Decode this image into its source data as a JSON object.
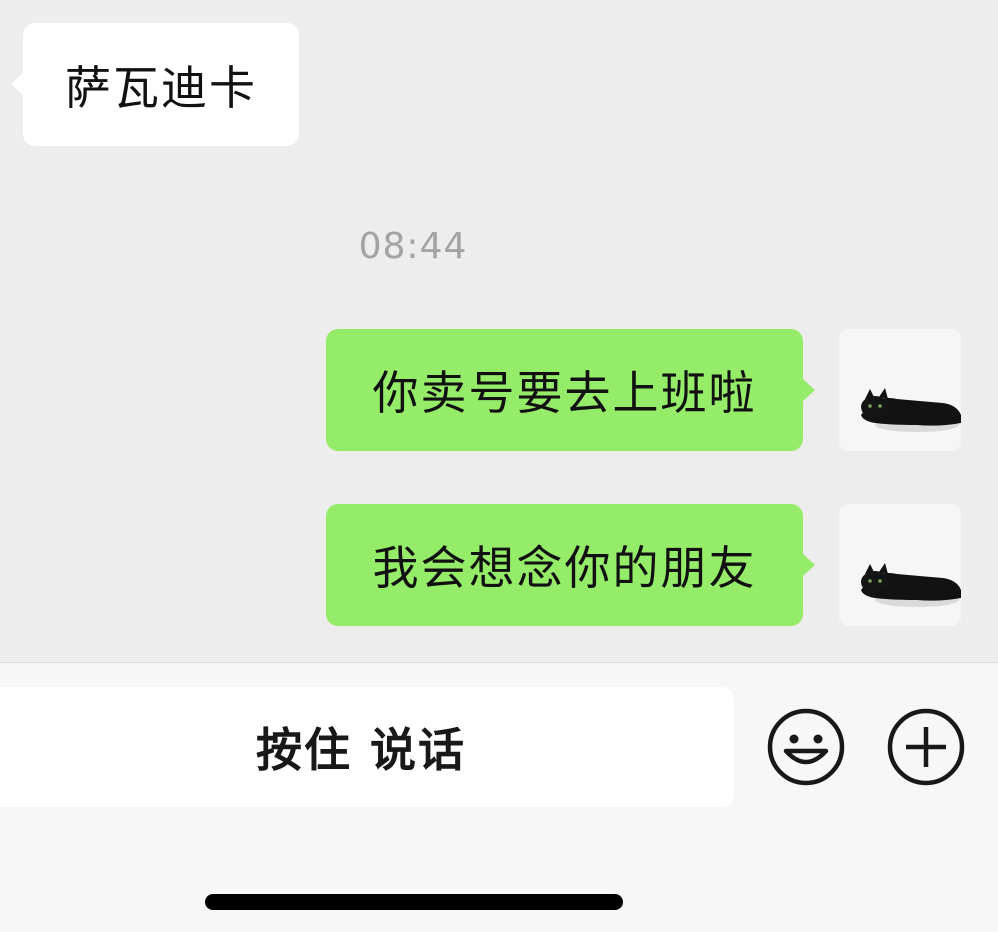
{
  "chat": {
    "messages": [
      {
        "sender": "contact",
        "text": "萨瓦迪卡"
      },
      {
        "sender": "me",
        "text": "你卖号要去上班啦"
      },
      {
        "sender": "me",
        "text": "我会想念你的朋友"
      }
    ],
    "timestamp": "08:44"
  },
  "input_bar": {
    "hold_to_talk_label": "按住 说话",
    "emoji_icon": "emoji-icon",
    "plus_icon": "plus-icon"
  },
  "colors": {
    "background": "#ededed",
    "outgoing_bubble": "#95ec69",
    "incoming_bubble": "#ffffff",
    "input_bar": "#f7f7f7"
  }
}
